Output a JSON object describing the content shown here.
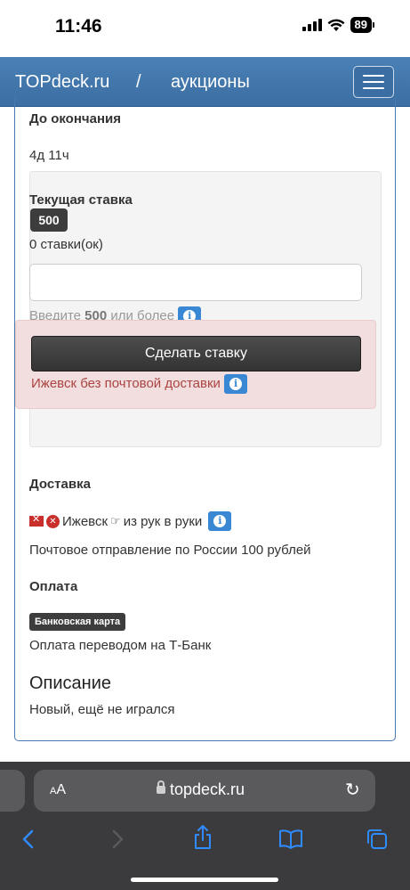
{
  "status_bar": {
    "time": "11:46",
    "battery": "89"
  },
  "navbar": {
    "brand": "TOPdeck.ru",
    "separator": "/",
    "section": "аукционы"
  },
  "auction": {
    "ending_label": "До окончания",
    "ending_value": "4д 11ч",
    "current_bid_label": "Текущая ставка",
    "current_bid_value": "500",
    "bids_count": "0 ставки(ок)",
    "bid_input_value": "",
    "hint_prefix": "Введите",
    "hint_amount": "500",
    "hint_suffix": "или более",
    "bid_button": "Сделать ставку",
    "alert_text": "Ижевск без почтовой доставки"
  },
  "delivery": {
    "heading": "Доставка",
    "city": "Ижевск",
    "hand_text": "из рук в руки",
    "post_text": "Почтовое отправление по России 100 рублей"
  },
  "payment": {
    "heading": "Оплата",
    "badge": "Банковская карта",
    "text": "Оплата переводом на Т-Банк"
  },
  "description": {
    "heading": "Описание",
    "text": "Новый, ещё не игрался"
  },
  "browser": {
    "aa_small": "A",
    "aa_big": "A",
    "url": "topdeck.ru"
  },
  "colors": {
    "navbar": "#3c6fa3",
    "info": "#3a87d3",
    "alert_bg": "#f2dede",
    "alert_text": "#a94442",
    "ios_blue": "#2f8bff"
  },
  "icons": {
    "info": "info-icon",
    "no_mail": "no-mail-icon",
    "no_circle": "x-circle-icon",
    "hand": "hand-pointing-icon",
    "back": "chevron-left-icon",
    "forward": "chevron-right-icon",
    "share": "share-icon",
    "bookmarks": "book-icon",
    "tabs": "tabs-icon",
    "reload": "reload-icon",
    "lock": "lock-icon"
  }
}
